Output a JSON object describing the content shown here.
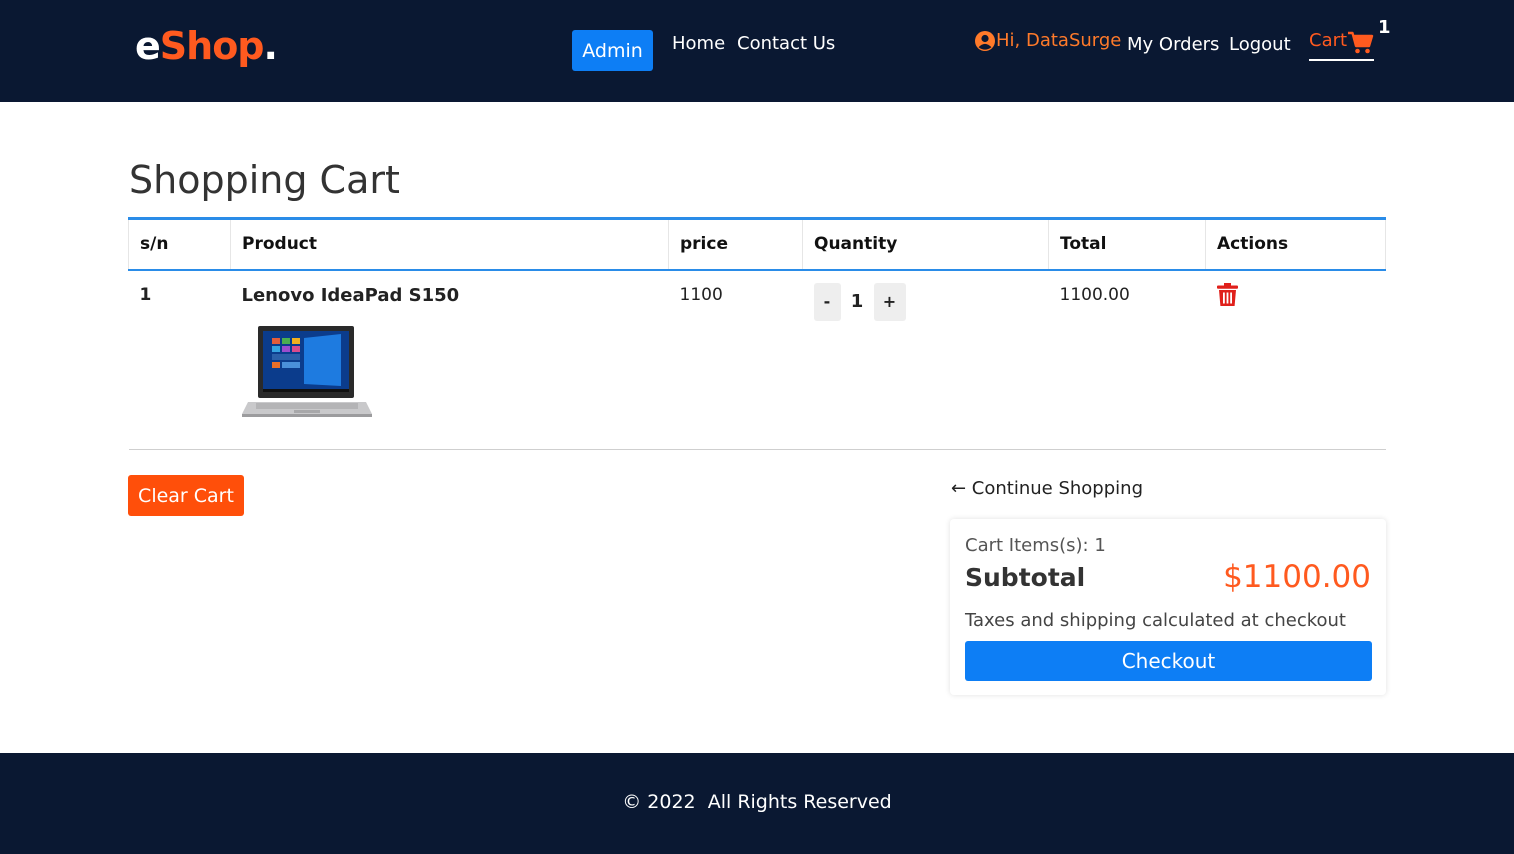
{
  "header": {
    "logo": {
      "part1": "e",
      "part2": "Shop",
      "part3": "."
    },
    "admin_label": "Admin",
    "nav": {
      "home": "Home",
      "contact": "Contact Us"
    },
    "greeting": "Hi, DataSurge",
    "my_orders": "My Orders",
    "logout": "Logout",
    "cart_label": "Cart",
    "cart_count": "1"
  },
  "page": {
    "title": "Shopping Cart"
  },
  "table": {
    "headers": [
      "s/n",
      "Product",
      "price",
      "Quantity",
      "Total",
      "Actions"
    ],
    "rows": [
      {
        "sn": "1",
        "product": "Lenovo IdeaPad S150",
        "price": "1100",
        "quantity": "1",
        "total": "1100.00"
      }
    ]
  },
  "controls": {
    "minus": "-",
    "plus": "+"
  },
  "clear_cart": "Clear Cart",
  "continue_shopping": "← Continue Shopping",
  "summary": {
    "items": "Cart Items(s): 1",
    "subtotal_label": "Subtotal",
    "subtotal_value": "$1100.00",
    "tax_note": "Taxes and shipping calculated at checkout",
    "checkout": "Checkout"
  },
  "footer": {
    "copyright": "© 2022  All Rights Reserved"
  },
  "colors": {
    "navy": "#0a1832",
    "accent_orange": "#ff5a1f",
    "primary_blue": "#0d7ef5",
    "danger_red": "#e0201b"
  },
  "icons": {
    "user": "user-circle-icon",
    "cart": "shopping-cart-icon",
    "delete": "trash-icon"
  }
}
